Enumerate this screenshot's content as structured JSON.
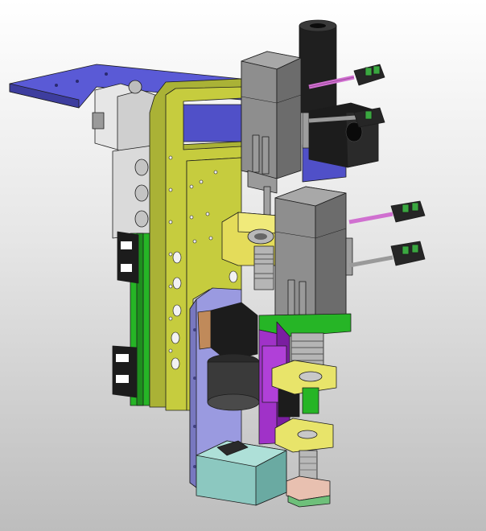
{
  "scene": {
    "background_top": "#ffffff",
    "background_bottom": "#bdbdbd"
  },
  "colors": {
    "base_plate": "#5a5ad6",
    "main_plate": "#c6cc3e",
    "motor_body": "#8e8e8e",
    "valve_block": "#d8d8d8",
    "slide_rail": "#26b526",
    "lavender_plate": "#9a9ae0",
    "bracket_yellow": "#e8e46a",
    "purple_plate": "#a032c8",
    "teal_block": "#8cc8c0",
    "black_block": "#1c1c1c",
    "cable_pink": "#d070d0",
    "connector_green": "#3aa840"
  }
}
